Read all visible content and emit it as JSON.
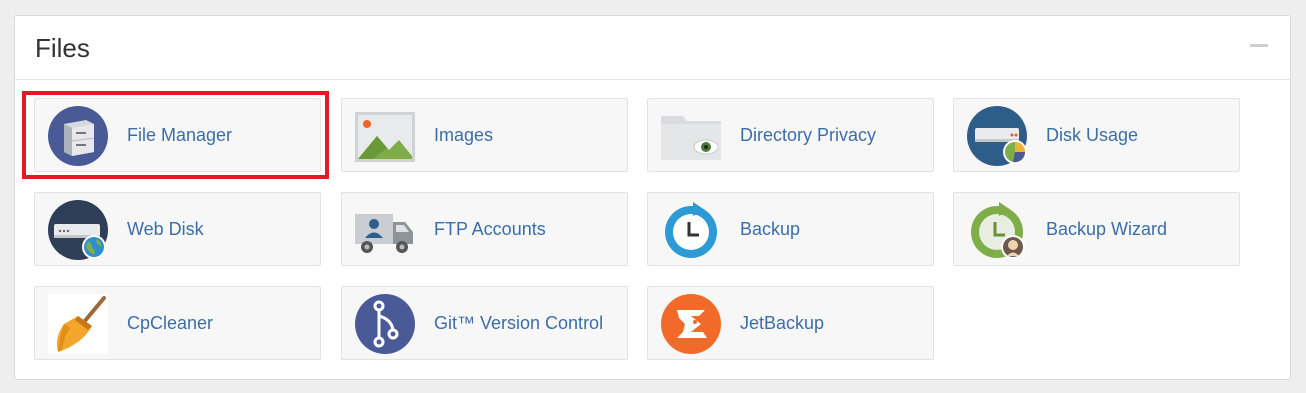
{
  "section": {
    "title": "Files",
    "collapse_icon": "minus-icon"
  },
  "items": [
    {
      "label": "File Manager",
      "icon": "file-manager-icon"
    },
    {
      "label": "Images",
      "icon": "images-icon"
    },
    {
      "label": "Directory Privacy",
      "icon": "directory-privacy-icon"
    },
    {
      "label": "Disk Usage",
      "icon": "disk-usage-icon"
    },
    {
      "label": "Web Disk",
      "icon": "web-disk-icon"
    },
    {
      "label": "FTP Accounts",
      "icon": "ftp-accounts-icon"
    },
    {
      "label": "Backup",
      "icon": "backup-icon"
    },
    {
      "label": "Backup Wizard",
      "icon": "backup-wizard-icon"
    },
    {
      "label": "CpCleaner",
      "icon": "cpcleaner-icon"
    },
    {
      "label": "Git™ Version Control",
      "icon": "git-icon"
    },
    {
      "label": "JetBackup",
      "icon": "jetbackup-icon"
    }
  ],
  "colors": {
    "link": "#3b6ea8",
    "highlight": "#e01b23",
    "tile_bg": "#f7f7f7"
  }
}
